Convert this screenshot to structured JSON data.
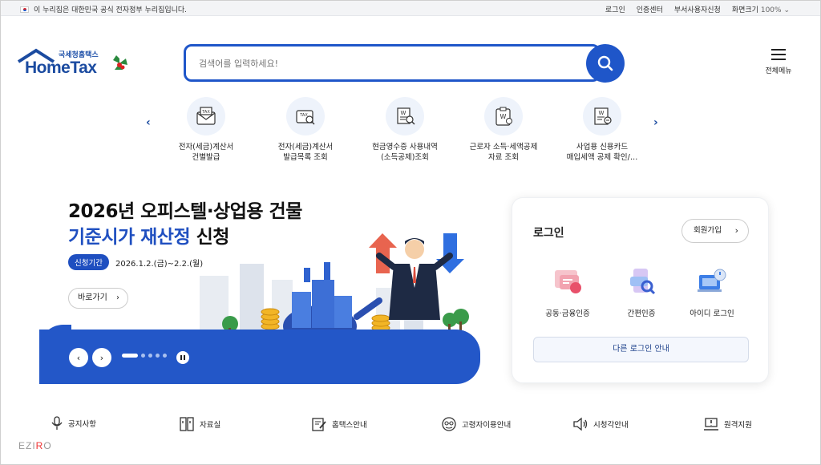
{
  "topbar": {
    "notice": "이 누리집은 대한민국 공식 전자정부 누리집입니다.",
    "links": [
      "로그인",
      "인증센터",
      "부서사용자신청"
    ],
    "zoom_label": "화면크기",
    "zoom_value": "100%"
  },
  "logo": {
    "sub": "국세청홈택스",
    "main": "HomeTax"
  },
  "search": {
    "placeholder": "검색어를 입력하세요!"
  },
  "menu_all": "전체메뉴",
  "quick_menu": [
    {
      "line1": "전자(세금)계산서",
      "line2": "건별발급",
      "icon": "tax-envelope-icon"
    },
    {
      "line1": "전자(세금)계산서",
      "line2": "발급목록 조회",
      "icon": "tax-search-icon"
    },
    {
      "line1": "현금영수증 사용내역",
      "line2": "(소득공제)조회",
      "icon": "receipt-search-icon"
    },
    {
      "line1": "근로자 소득·세액공제",
      "line2": "자료 조회",
      "icon": "clipboard-won-icon"
    },
    {
      "line1": "사업용 신용카드",
      "line2": "매입세액 공제 확인/…",
      "icon": "card-document-icon"
    }
  ],
  "banner": {
    "title_line1": "2026년 오피스텔·상업용 건물",
    "title_blue": "기준시가 재산정",
    "title_rest": " 신청",
    "period_badge": "신청기간",
    "period": "2026.1.2.(금)~2.2.(월)",
    "goto": "바로가기",
    "slide_count": 5,
    "active_slide": 1
  },
  "login": {
    "title": "로그인",
    "join": "회원가입",
    "options": [
      "공동·금융인증",
      "간편인증",
      "아이디 로그인"
    ],
    "other": "다른 로그인 안내"
  },
  "bottom_menu": [
    {
      "label": "공지사항",
      "icon": "microphone-icon"
    },
    {
      "label": "자료실",
      "icon": "archive-icon"
    },
    {
      "label": "홈택스안내",
      "icon": "note-pen-icon"
    },
    {
      "label": "고령자이용안내",
      "icon": "senior-icon"
    },
    {
      "label": "시청각안내",
      "icon": "speaker-icon"
    },
    {
      "label": "원격지원",
      "icon": "remote-support-icon"
    }
  ],
  "watermark": "EZIRO",
  "colors": {
    "primary": "#1f56c9",
    "text": "#222222",
    "topbar": "#f3f4f6"
  }
}
